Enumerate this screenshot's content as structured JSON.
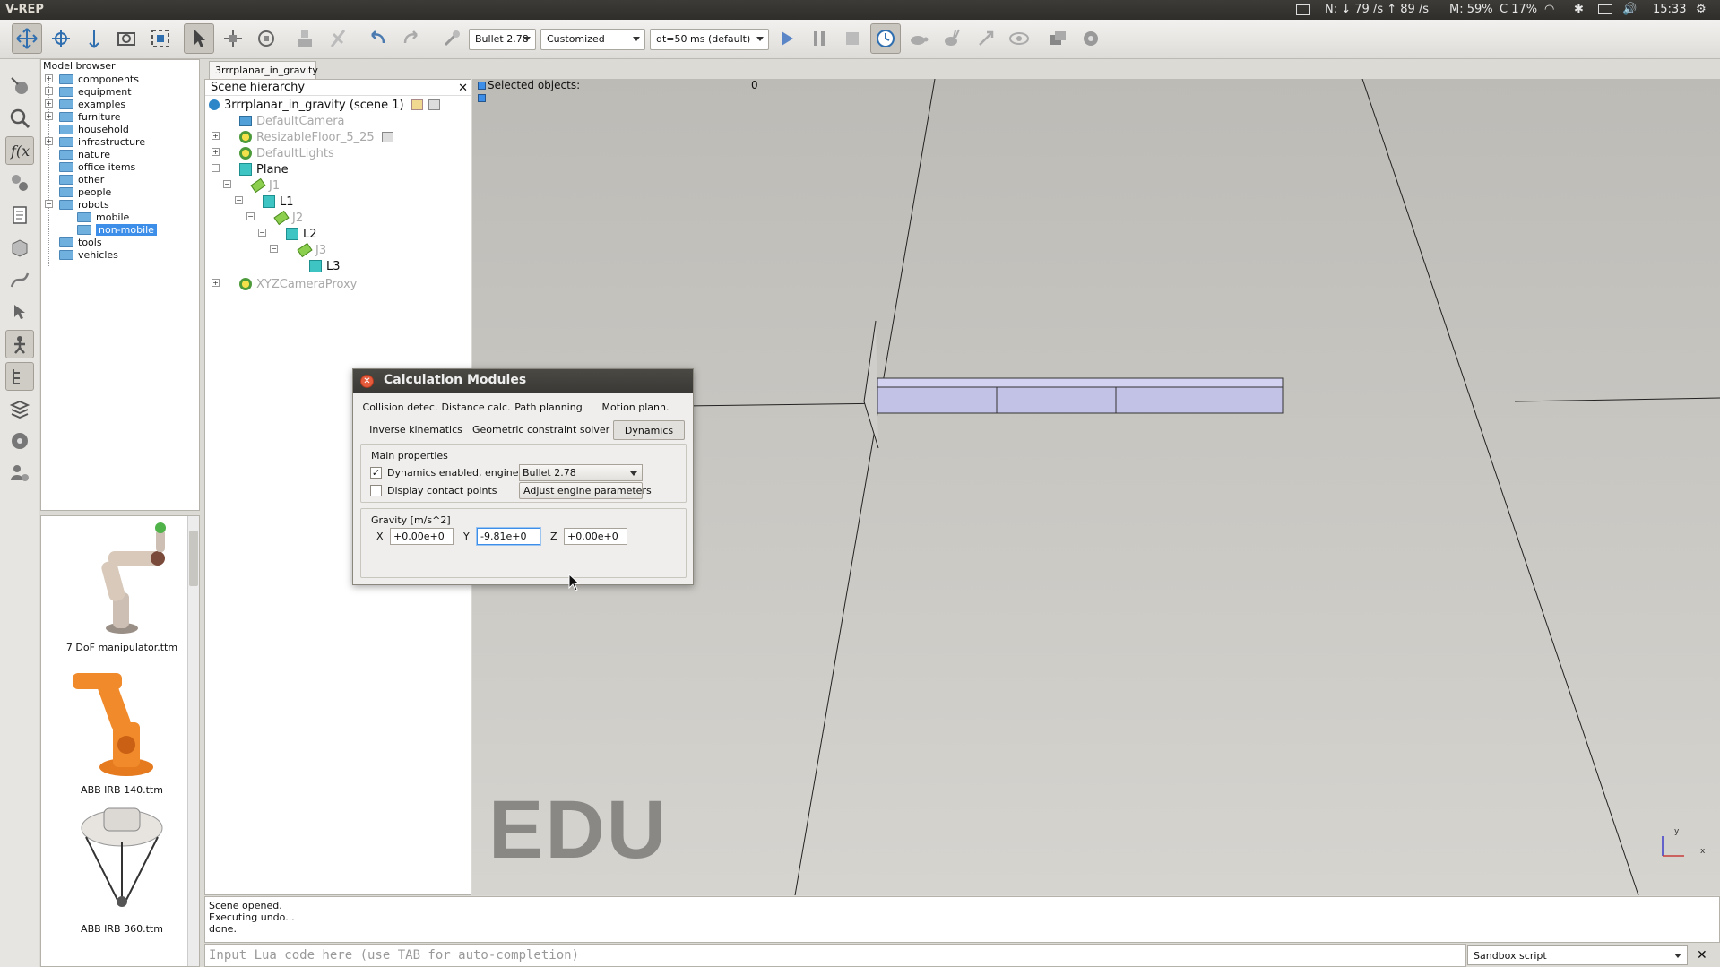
{
  "topbar": {
    "app_title": "V-REP",
    "net_label": "N: ↓  79 /s  ↑  89 /s",
    "mem_label": "M: 59%",
    "cpu_label": "C 17%",
    "clock": "15:33"
  },
  "toolbar": {
    "engine_combo": "Bullet 2.78",
    "preset_combo": "Customized",
    "dt_combo": "dt=50 ms (default)"
  },
  "model_browser": {
    "title": "Model browser",
    "items": [
      {
        "label": "components"
      },
      {
        "label": "equipment"
      },
      {
        "label": "examples"
      },
      {
        "label": "furniture"
      },
      {
        "label": "household"
      },
      {
        "label": "infrastructure"
      },
      {
        "label": "nature"
      },
      {
        "label": "office items"
      },
      {
        "label": "other"
      },
      {
        "label": "people"
      },
      {
        "label": "robots"
      },
      {
        "label": "mobile"
      },
      {
        "label": "non-mobile"
      },
      {
        "label": "tools"
      },
      {
        "label": "vehicles"
      }
    ],
    "thumbnails": [
      {
        "label": "7 DoF manipulator.ttm"
      },
      {
        "label": "ABB IRB 140.ttm"
      },
      {
        "label": "ABB IRB 360.ttm"
      }
    ]
  },
  "scene": {
    "tab": "3rrrplanar_in_gravity",
    "hierarchy_title": "Scene hierarchy",
    "items": [
      {
        "label": "3rrrplanar_in_gravity (scene 1)"
      },
      {
        "label": "DefaultCamera"
      },
      {
        "label": "ResizableFloor_5_25"
      },
      {
        "label": "DefaultLights"
      },
      {
        "label": "Plane"
      },
      {
        "label": "J1"
      },
      {
        "label": "L1"
      },
      {
        "label": "J2"
      },
      {
        "label": "L2"
      },
      {
        "label": "J3"
      },
      {
        "label": "L3"
      },
      {
        "label": "XYZCameraProxy"
      }
    ]
  },
  "viewport": {
    "selected_label": "Selected objects:",
    "selected_count": "0",
    "watermark": "EDU",
    "axis_y": "y",
    "axis_x": "x"
  },
  "console": {
    "lines": [
      "Scene opened.",
      "Executing undo...",
      "done."
    ],
    "input_placeholder": "Input Lua code here (use TAB for auto-completion)",
    "script_mode": "Sandbox script"
  },
  "dialog": {
    "title": "Calculation Modules",
    "tabs": [
      {
        "label": "Collision detec."
      },
      {
        "label": "Distance calc."
      },
      {
        "label": "Path planning"
      },
      {
        "label": "Motion plann."
      },
      {
        "label": "Inverse kinematics"
      },
      {
        "label": "Geometric constraint solver"
      },
      {
        "label": "Dynamics"
      }
    ],
    "main_group": "Main properties",
    "dyn_enabled_label": "Dynamics enabled, engine to use",
    "engine": "Bullet 2.78",
    "contact_label": "Display contact points",
    "adjust_button": "Adjust engine parameters",
    "gravity_group": "Gravity [m/s^2]",
    "gx_label": "X",
    "gx": "+0.00e+0",
    "gy_label": "Y",
    "gy": "-9.81e+0",
    "gz_label": "Z",
    "gz": "+0.00e+0"
  }
}
